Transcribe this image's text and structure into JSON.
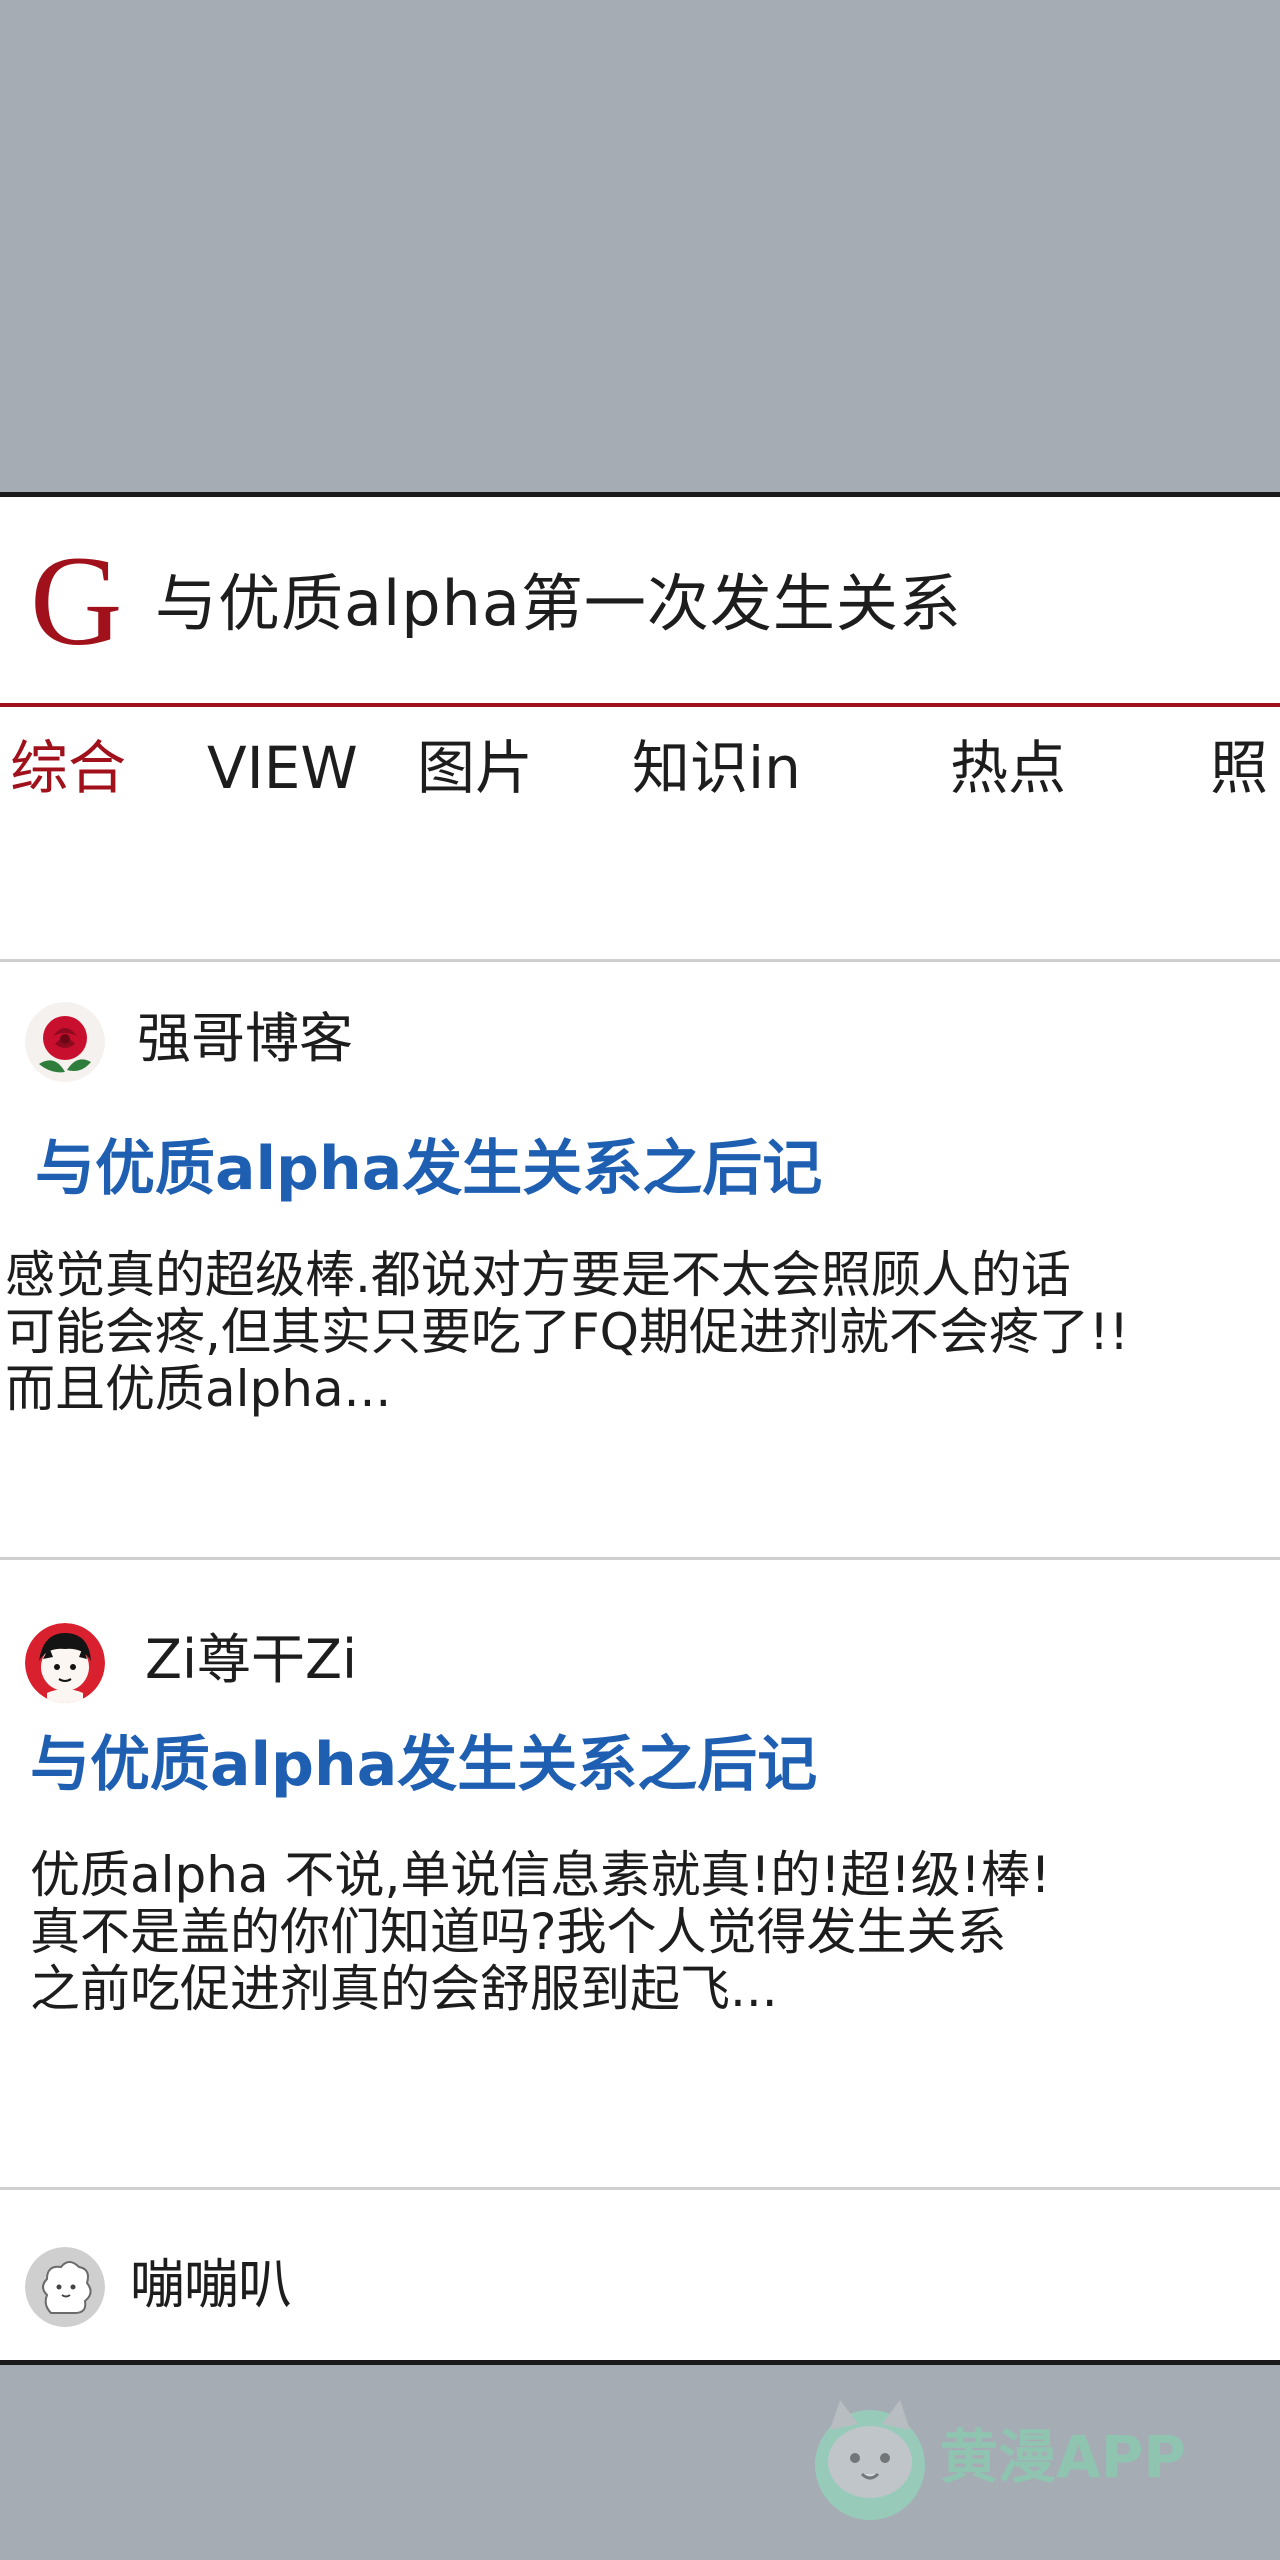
{
  "search": {
    "logo": "G",
    "query": "与优质alpha第一次发生关系"
  },
  "tabs": [
    {
      "label": "综合",
      "active": true
    },
    {
      "label": "VIEW"
    },
    {
      "label": "图片"
    },
    {
      "label": "知识in"
    },
    {
      "label": "热点"
    },
    {
      "label": "照"
    }
  ],
  "results": [
    {
      "author": "强哥博客",
      "avatar_icon": "rose-avatar-icon",
      "title": "与优质alpha发生关系之后记",
      "snippet": [
        "感觉真的超级棒.都说对方要是不太会照顾人的话",
        "可能会疼,但其实只要吃了FQ期促进剂就不会疼了!!",
        "而且优质alpha..."
      ]
    },
    {
      "author": "Zi尊干Zi",
      "avatar_icon": "anime-boy-avatar-icon",
      "title": "与优质alpha发生关系之后记",
      "snippet": [
        "优质alpha 不说,单说信息素就真!的!超!级!棒!",
        "真不是盖的你们知道吗?我个人觉得发生关系",
        "之前吃促进剂真的会舒服到起飞..."
      ]
    },
    {
      "author": "嘣嘣叭",
      "avatar_icon": "cloud-sprite-avatar-icon",
      "title": "",
      "snippet": []
    }
  ],
  "watermark": {
    "icon": "cat-logo-icon",
    "text": "黄漫APP"
  },
  "colors": {
    "brand_red": "#a0111b",
    "link_blue": "#1f5fb2",
    "backdrop_gray": "#a5acb3"
  }
}
